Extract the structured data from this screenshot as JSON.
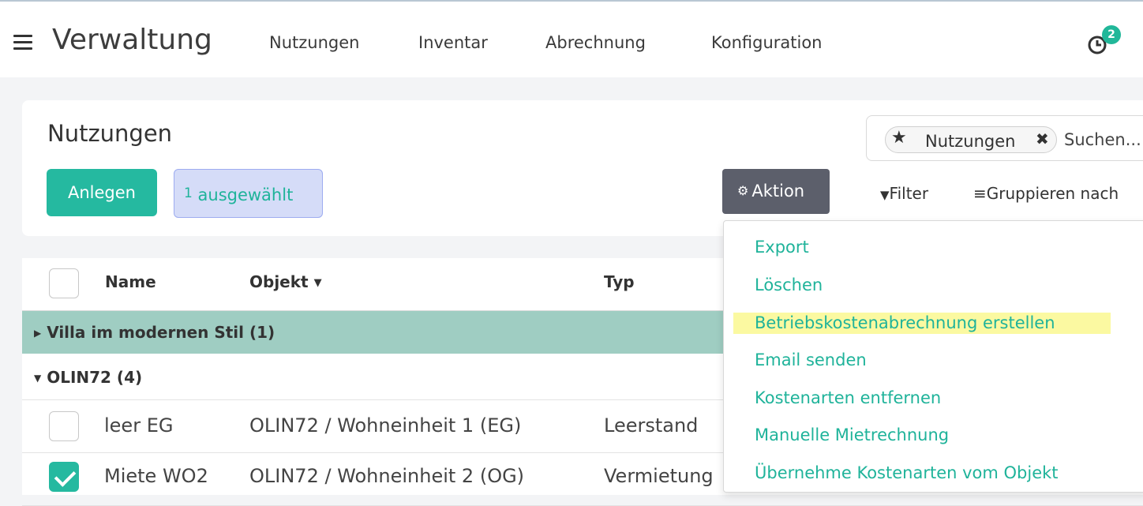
{
  "topbar": {
    "title": "Verwaltung",
    "nav": [
      "Nutzungen",
      "Inventar",
      "Abrechnung",
      "Konfiguration"
    ],
    "activity_badge": "2"
  },
  "control_panel": {
    "title": "Nutzungen",
    "create_label": "Anlegen",
    "selected_count": "1",
    "selected_label": "ausgewählt",
    "facet_label": "Nutzungen",
    "search_placeholder": "Suchen...",
    "action_label": "Aktion",
    "filter_label": "Filter",
    "group_label": "Gruppieren nach"
  },
  "list": {
    "columns": [
      "Name",
      "Objekt",
      "Typ"
    ],
    "groups": [
      {
        "label": "Villa im modernen Stil (1)",
        "expanded": false
      },
      {
        "label": "OLIN72 (4)",
        "expanded": true
      }
    ],
    "rows": [
      {
        "name": "leer EG",
        "objekt": "OLIN72 / Wohneinheit 1 (EG)",
        "typ": "Leerstand",
        "checked": false
      },
      {
        "name": "Miete WO2",
        "objekt": "OLIN72 / Wohneinheit 2 (OG)",
        "typ": "Vermietung",
        "checked": true
      }
    ]
  },
  "action_menu": {
    "items": [
      "Export",
      "Löschen",
      "Betriebskostenabrechnung erstellen",
      "Email senden",
      "Kostenarten entfernen",
      "Manuelle Mietrechnung",
      "Übernehme Kostenarten vom Objekt"
    ],
    "highlighted_index": 2
  },
  "colors": {
    "accent": "#25b9a0",
    "group_row_bg": "#9fcdc2",
    "action_button_bg": "#5c5f6b",
    "highlight": "#fbf9a1"
  }
}
